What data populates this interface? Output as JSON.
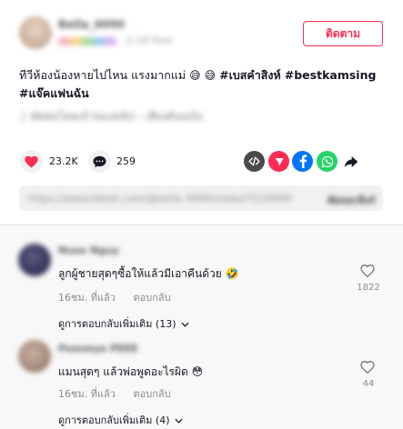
{
  "author": {
    "name": "Bella_0090",
    "meta_suffix": "· 2-18 Post"
  },
  "follow_label": "ติดตาม",
  "caption": {
    "text": "ทีวีห้องน้องหายไปไหน แรงมากแม่",
    "emoji1": "😅",
    "emoji2": "😅",
    "tag1": "#เบสคำสิงห์",
    "tag2": "#bestkamsing",
    "tag3": "#แจ๊คแฟนฉัน",
    "sub": "♪ ตัดต่อโดยเจ้าของคลิป - เสียงต้นฉบับ"
  },
  "actions": {
    "likes": "23.2K",
    "comments": "259"
  },
  "share_icons": [
    "embed-icon",
    "send-icon",
    "facebook-icon",
    "whatsapp-icon",
    "share-arrow-icon"
  ],
  "colors": {
    "accent": "#fe2c55",
    "embed": "#4a4a4a",
    "send": "#fe2c55",
    "facebook": "#0075fa",
    "whatsapp": "#25d366",
    "share": "#161823"
  },
  "link_bar": {
    "url": "https://www.tiktok.com/@bella_0090/video/7210000000000000000",
    "copy_label": "คัดลอกลิงก์"
  },
  "comments": [
    {
      "name": "Nuse Nguy",
      "text": "ลูกผู้ชายสุดๆซื้อให้แล้วมีเอาคืนด้วย",
      "emoji": "🤣",
      "time": "16ชม. ที่แล้ว",
      "reply_label": "ตอบกลับ",
      "view_replies": "ดูการตอบกลับเพิ่มเติม (13)",
      "like_count": "1822"
    },
    {
      "name": "Pommye PEEE",
      "text": "แมนสุดๆ แล้วพ่อพูดอะไรผิด",
      "emoji": "😳",
      "time": "16ชม. ที่แล้ว",
      "reply_label": "ตอบกลับ",
      "view_replies": "ดูการตอบกลับเพิ่มเติม (4)",
      "like_count": "44"
    }
  ]
}
